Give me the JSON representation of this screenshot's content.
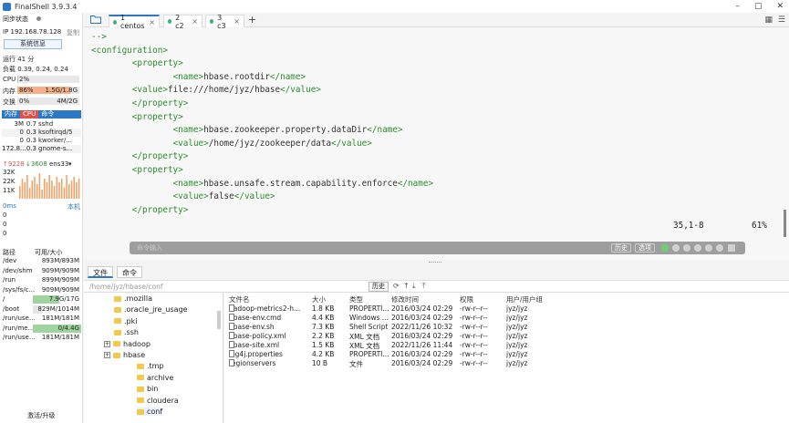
{
  "app": {
    "title": "FinalShell 3.9.3.4"
  },
  "window_controls": {
    "minimize": "–",
    "maximize": "▢",
    "close": "✕"
  },
  "sidebar": {
    "sync_status": "同步状态",
    "ip_label": "IP 192.168.78.128",
    "copy_label": "复制",
    "sysinfo_button": "系统信息",
    "uptime": "运行 41 分",
    "load": "负载 0.39, 0.24, 0.24",
    "cpu_label": "CPU",
    "cpu_value": "2%",
    "cpu_fraction": 0.02,
    "mem_label": "内存",
    "mem_percent": "86%",
    "mem_value": "1.5G/1.8G",
    "mem_fraction": 0.86,
    "swap_label": "交换",
    "swap_percent": "0%",
    "swap_value": "4M/2G",
    "swap_fraction": 0.0,
    "process_tabs": [
      "内存",
      "CPU",
      "命令"
    ],
    "processes": [
      {
        "mem": "3M",
        "cpu": "0.7",
        "name": "sshd"
      },
      {
        "mem": "0",
        "cpu": "0.3",
        "name": "ksoftirqd/5"
      },
      {
        "mem": "0",
        "cpu": "0.3",
        "name": "kworker/..."
      },
      {
        "mem": "172.8...",
        "cpu": "0.3",
        "name": "gnome-s..."
      }
    ],
    "net_up": "↑9228",
    "net_down": "↓3608",
    "net_iface": "ens33",
    "net_scale": [
      "32K",
      "22K",
      "11K"
    ],
    "ping_label": "0ms",
    "ping_local": "本机",
    "ping_values": [
      "0",
      "0",
      "0"
    ],
    "disk_headers": [
      "路径",
      "可用/大小"
    ],
    "disks": [
      {
        "path": "/dev",
        "size": "893M/893M",
        "fraction": 0.0
      },
      {
        "path": "/dev/shm",
        "size": "909M/909M",
        "fraction": 0.0
      },
      {
        "path": "/run",
        "size": "899M/909M",
        "fraction": 0.0
      },
      {
        "path": "/sys/fs/c...",
        "size": "909M/909M",
        "fraction": 0.0
      },
      {
        "path": "/",
        "size": "7.9G/17G",
        "fraction": 0.54
      },
      {
        "path": "/boot",
        "size": "829M/1014M",
        "fraction": 0.18
      },
      {
        "path": "/run/use...",
        "size": "181M/181M",
        "fraction": 0.0
      },
      {
        "path": "/run/me...",
        "size": "0/4.4G",
        "fraction": 1.0
      },
      {
        "path": "/run/use...",
        "size": "181M/181M",
        "fraction": 0.0
      }
    ],
    "activate": "激活/升级"
  },
  "tabs": [
    {
      "label": "1 centos",
      "active": true
    },
    {
      "label": "2 c2",
      "active": false
    },
    {
      "label": "3 c3",
      "active": false
    }
  ],
  "tab_close": "×",
  "tab_add": "+",
  "terminal": {
    "lines": [
      "-->",
      "<configuration>",
      "        <property>",
      "                <name>hbase.rootdir</name>",
      "        <value>file:///home/jyz/hbase</value>",
      "        </property>",
      "        <property>",
      "                <name>hbase.zookeeper.property.dataDir</name>",
      "                <value>/home/jyz/zookeeper/data</value>",
      "        </property>",
      "        <property>",
      "                <name>hbase.unsafe.stream.capability.enforce</name>",
      "                <value>false</value>",
      "        </property>"
    ],
    "cursor_pos": "35,1-8",
    "percent": "61%",
    "cmd_placeholder": "命令输入",
    "history_btn": "历史",
    "options_btn": "选项"
  },
  "bottom_tabs": [
    "文件",
    "命令"
  ],
  "file_path": "/home/jyz/hbase/conf",
  "history_button": "历史",
  "tree": [
    {
      "name": ".mozilla",
      "indent": 1,
      "expandable": false
    },
    {
      "name": ".oracle_jre_usage",
      "indent": 1,
      "expandable": false
    },
    {
      "name": ".pki",
      "indent": 1,
      "expandable": false
    },
    {
      "name": ".ssh",
      "indent": 1,
      "expandable": false
    },
    {
      "name": "hadoop",
      "indent": 1,
      "expandable": true
    },
    {
      "name": "hbase",
      "indent": 1,
      "expandable": true
    },
    {
      "name": ".tmp",
      "indent": 2,
      "expandable": false
    },
    {
      "name": "archive",
      "indent": 2,
      "expandable": false
    },
    {
      "name": "bin",
      "indent": 2,
      "expandable": false
    },
    {
      "name": "cloudera",
      "indent": 2,
      "expandable": false
    },
    {
      "name": "conf",
      "indent": 2,
      "expandable": false
    }
  ],
  "file_headers": [
    "文件名",
    "大小",
    "类型",
    "修改时间",
    "权限",
    "用户/用户组"
  ],
  "files": [
    {
      "name": "hadoop-metrics2-h...",
      "size": "1.8 KB",
      "type": "PROPERTI...",
      "mtime": "2016/03/24 02:29",
      "perm": "-rw-r--r--",
      "owner": "jyz/jyz"
    },
    {
      "name": "hbase-env.cmd",
      "size": "4.4 KB",
      "type": "Windows ...",
      "mtime": "2016/03/24 02:29",
      "perm": "-rw-r--r--",
      "owner": "jyz/jyz"
    },
    {
      "name": "hbase-env.sh",
      "size": "7.3 KB",
      "type": "Shell Script",
      "mtime": "2022/11/26 10:32",
      "perm": "-rw-r--r--",
      "owner": "jyz/jyz"
    },
    {
      "name": "hbase-policy.xml",
      "size": "2.2 KB",
      "type": "XML 文档",
      "mtime": "2016/03/24 02:29",
      "perm": "-rw-r--r--",
      "owner": "jyz/jyz"
    },
    {
      "name": "hbase-site.xml",
      "size": "1.5 KB",
      "type": "XML 文档",
      "mtime": "2022/11/26 11:44",
      "perm": "-rw-r--r--",
      "owner": "jyz/jyz"
    },
    {
      "name": "log4j.properties",
      "size": "4.2 KB",
      "type": "PROPERTI...",
      "mtime": "2016/03/24 02:29",
      "perm": "-rw-r--r--",
      "owner": "jyz/jyz"
    },
    {
      "name": "regionservers",
      "size": "10 B",
      "type": "文件",
      "mtime": "2016/03/24 02:29",
      "perm": "-rw-r--r--",
      "owner": "jyz/jyz"
    }
  ]
}
